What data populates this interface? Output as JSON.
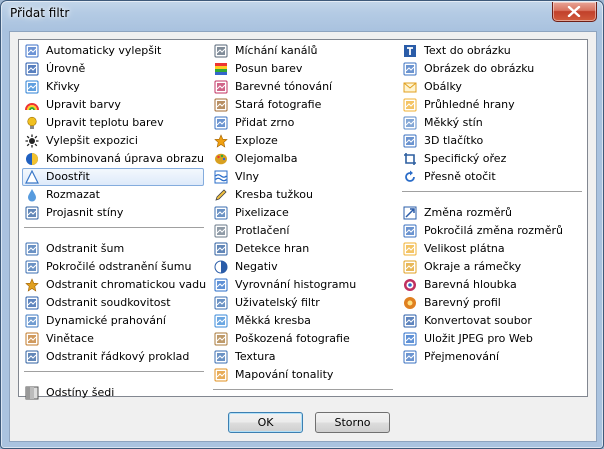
{
  "window": {
    "title": "Přidat filtr"
  },
  "columns": [
    [
      {
        "label": "Automaticky vylepšit",
        "icon": "wand-icon",
        "color": "#3b6fc7"
      },
      {
        "label": "Úrovně",
        "icon": "levels-icon",
        "color": "#2255aa"
      },
      {
        "label": "Křivky",
        "icon": "curves-icon",
        "color": "#2a7fd4"
      },
      {
        "label": "Upravit barvy",
        "icon": "rainbow-icon",
        "color": "#e8382c"
      },
      {
        "label": "Upravit teplotu barev",
        "icon": "bulb-icon",
        "color": "#f0c020"
      },
      {
        "label": "Vylepšit expozici",
        "icon": "exposure-icon",
        "color": "#444444"
      },
      {
        "label": "Kombinovaná úprava obrazu",
        "icon": "combo-icon",
        "color": "#2060c0"
      },
      {
        "label": "Doostřit",
        "icon": "sharpen-icon",
        "color": "#3a78c8",
        "selected": true
      },
      {
        "label": "Rozmazat",
        "icon": "blur-drop-icon",
        "color": "#3a8ad8"
      },
      {
        "label": "Projasnit stíny",
        "icon": "shadows-icon",
        "color": "#2d5fa0"
      },
      {
        "separator": true
      },
      {
        "label": "Odstranit šum",
        "icon": "noise-icon",
        "color": "#3a6db0"
      },
      {
        "label": "Pokročilé odstranění šumu",
        "icon": "adv-noise-icon",
        "color": "#3a6db0"
      },
      {
        "label": "Odstranit chromatickou vadu",
        "icon": "star-icon",
        "color": "#e0a020"
      },
      {
        "label": "Odstranit soudkovitost",
        "icon": "barrel-icon",
        "color": "#2a5ca8"
      },
      {
        "label": "Dynamické prahování",
        "icon": "threshold-icon",
        "color": "#3f7ac0"
      },
      {
        "label": "Vinětace",
        "icon": "vignette-icon",
        "color": "#c07828"
      },
      {
        "label": "Odstranit řádkový proklad",
        "icon": "deinterlace-icon",
        "color": "#2d5fa0"
      },
      {
        "separator": true
      },
      {
        "label": "Odstíny šedi",
        "icon": "grayscale-icon",
        "color": "#777777"
      }
    ],
    [
      {
        "label": "Míchání kanálů",
        "icon": "channel-mixer-icon",
        "color": "#556677"
      },
      {
        "label": "Posun barev",
        "icon": "color-shift-icon",
        "color": "#d84a2a"
      },
      {
        "label": "Barevné tónování",
        "icon": "tint-icon",
        "color": "#c03060"
      },
      {
        "label": "Stará fotografie",
        "icon": "old-photo-icon",
        "color": "#a06a30"
      },
      {
        "label": "Přidat zrno",
        "icon": "grain-icon",
        "color": "#3a70c0"
      },
      {
        "label": "Exploze",
        "icon": "explosion-icon",
        "color": "#f0a010"
      },
      {
        "label": "Olejomalba",
        "icon": "palette-icon",
        "color": "#d8a020"
      },
      {
        "label": "Vlny",
        "icon": "waves-icon",
        "color": "#2a6cc8"
      },
      {
        "label": "Kresba tužkou",
        "icon": "pencil-icon",
        "color": "#555555"
      },
      {
        "label": "Pixelizace",
        "icon": "pixelate-icon",
        "color": "#3a6db0"
      },
      {
        "label": "Protlačení",
        "icon": "emboss-icon",
        "color": "#6a7a8a"
      },
      {
        "label": "Detekce hran",
        "icon": "edges-icon",
        "color": "#2d5fa0"
      },
      {
        "label": "Negativ",
        "icon": "negative-icon",
        "color": "#2a5ca8"
      },
      {
        "label": "Vyrovnání histogramu",
        "icon": "histogram-icon",
        "color": "#2a6cc8"
      },
      {
        "label": "Uživatelský filtr",
        "icon": "custom-filter-icon",
        "color": "#3a6db0"
      },
      {
        "label": "Měkká kresba",
        "icon": "soft-draw-icon",
        "color": "#3a8ad8"
      },
      {
        "label": "Poškozená fotografie",
        "icon": "damaged-photo-icon",
        "color": "#a87838"
      },
      {
        "label": "Textura",
        "icon": "texture-icon",
        "color": "#3a6db0"
      },
      {
        "label": "Mapování tonality",
        "icon": "tone-map-icon",
        "color": "#e09020"
      },
      {
        "separator": true
      }
    ],
    [
      {
        "label": "Text do obrázku",
        "icon": "text-icon",
        "color": "#2a5ca8"
      },
      {
        "label": "Obrázek do obrázku",
        "icon": "picture-in-picture-icon",
        "color": "#3a70c0"
      },
      {
        "label": "Obálky",
        "icon": "envelope-icon",
        "color": "#e0a020"
      },
      {
        "label": "Průhledné hrany",
        "icon": "transparent-edges-icon",
        "color": "#f0b030"
      },
      {
        "label": "Měkký stín",
        "icon": "soft-shadow-icon",
        "color": "#5a8ac8"
      },
      {
        "label": "3D tlačítko",
        "icon": "button-3d-icon",
        "color": "#3a70c0"
      },
      {
        "label": "Specifický ořez",
        "icon": "crop-icon",
        "color": "#2d5fa0"
      },
      {
        "label": "Přesně otočit",
        "icon": "rotate-icon",
        "color": "#2a6cc8"
      },
      {
        "separator": true
      },
      {
        "label": "Změna rozměrů",
        "icon": "resize-icon",
        "color": "#2a5ca8"
      },
      {
        "label": "Pokročilá změna rozměrů",
        "icon": "adv-resize-icon",
        "color": "#3a70c0"
      },
      {
        "label": "Velikost plátna",
        "icon": "canvas-size-icon",
        "color": "#f0b030"
      },
      {
        "label": "Okraje a rámečky",
        "icon": "frame-icon",
        "color": "#e0a020"
      },
      {
        "label": "Barevná hloubka",
        "icon": "color-depth-icon",
        "color": "#c03060"
      },
      {
        "label": "Barevný profil",
        "icon": "color-profile-icon",
        "color": "#e08020"
      },
      {
        "label": "Konvertovat soubor",
        "icon": "convert-icon",
        "color": "#2a5ca8"
      },
      {
        "label": "Uložit JPEG pro Web",
        "icon": "save-jpeg-icon",
        "color": "#2a6cc8"
      },
      {
        "label": "Přejmenování",
        "icon": "rename-icon",
        "color": "#3a70c0"
      }
    ]
  ],
  "buttons": {
    "ok": "OK",
    "cancel": "Storno"
  }
}
